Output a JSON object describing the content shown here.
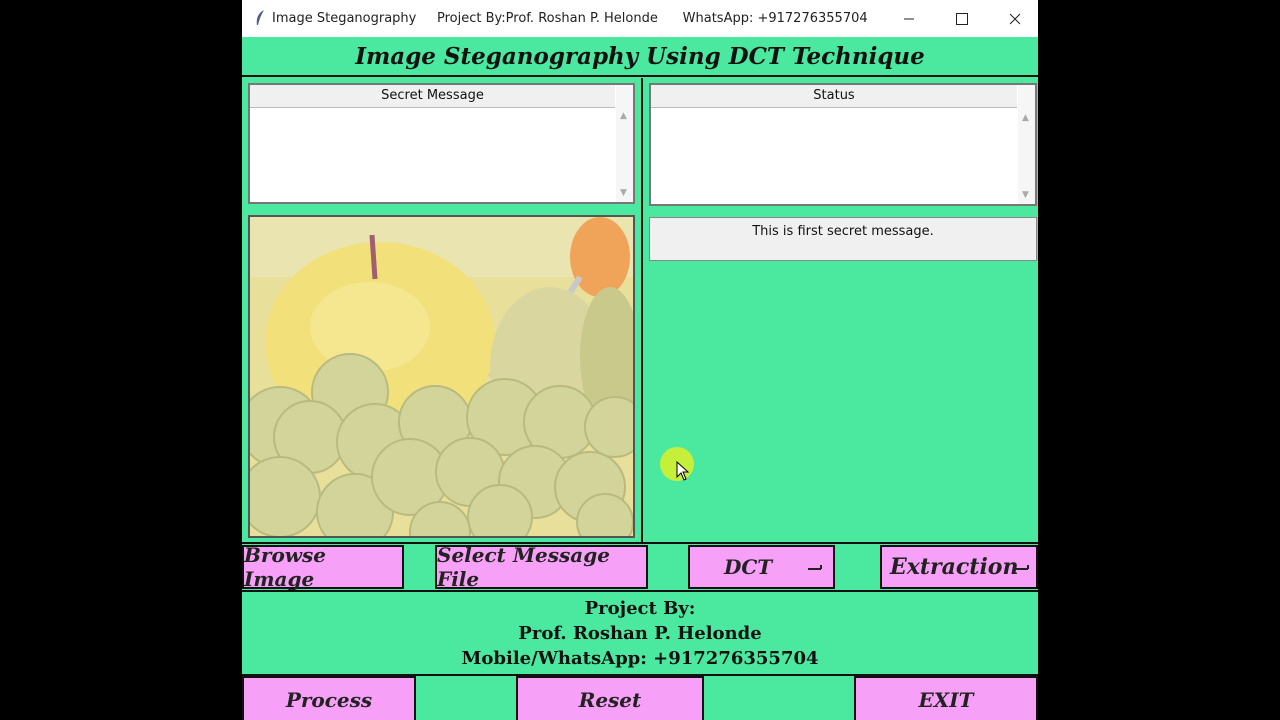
{
  "window": {
    "title": "Image Steganography     Project By:Prof. Roshan P. Helonde      WhatsApp: +917276355704",
    "controls": [
      "minimize",
      "maximize",
      "close"
    ]
  },
  "heading": "Image Steganography Using DCT Technique",
  "secret_message": {
    "header": "Secret Message",
    "value": ""
  },
  "status": {
    "header": "Status",
    "value": ""
  },
  "extracted_message": "This is first secret message.",
  "image": {
    "description_icon": "fruit-image",
    "alt": ""
  },
  "buttons": {
    "browse": "Browse Image",
    "select_message": "Select Message File",
    "dct": "DCT",
    "extraction": "Extraction",
    "process": "Process",
    "reset": "Reset",
    "exit": "EXIT"
  },
  "credits": {
    "line1": "Project By:",
    "line2": "Prof. Roshan P. Helonde",
    "line3": "Mobile/WhatsApp: +917276355704"
  },
  "colors": {
    "background": "#4be8a0",
    "button": "#f7a0f7"
  }
}
